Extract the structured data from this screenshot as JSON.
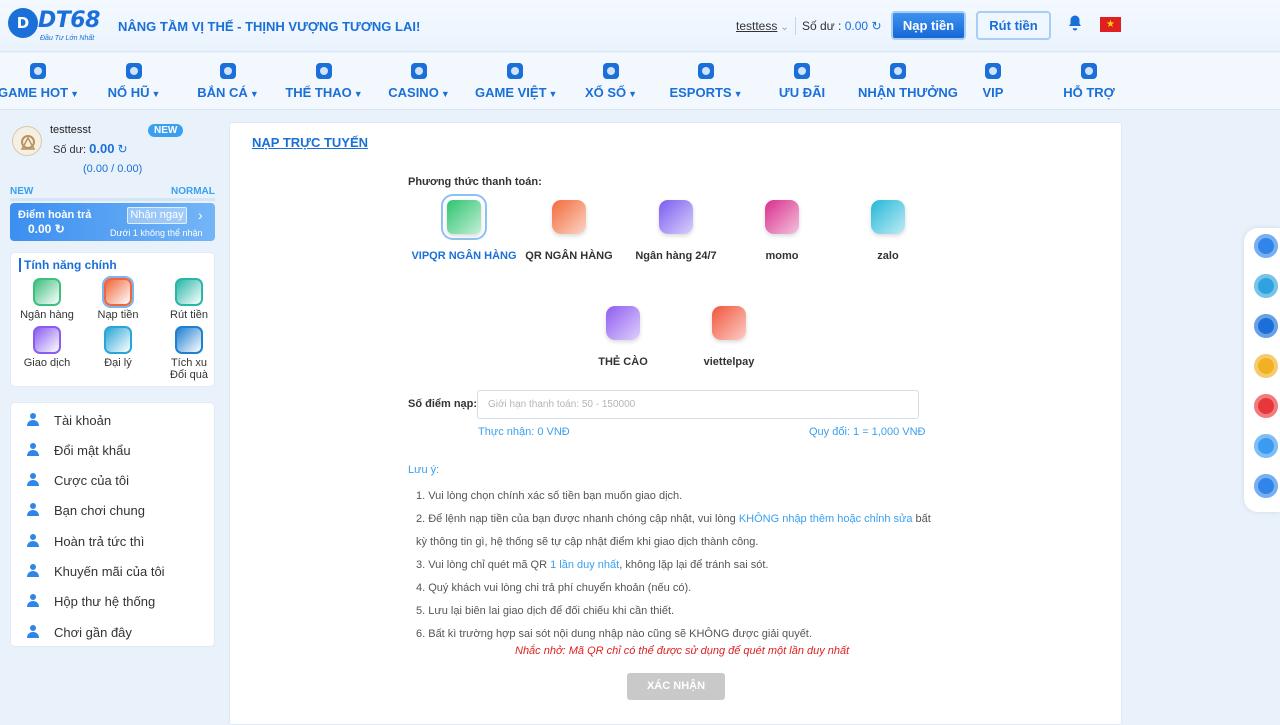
{
  "header": {
    "logo_text": "DT68",
    "logo_sub": "Đầu Tư Lớn Nhất",
    "slogan": "NÂNG TẦM VỊ THẾ - THỊNH VƯỢNG TƯƠNG LAI!",
    "username": "testtess",
    "balance_label": "Số dư :",
    "balance_value": "0.00",
    "deposit_btn": "Nạp tiền",
    "withdraw_btn": "Rút tiền"
  },
  "nav": [
    {
      "label": "GAME HOT",
      "caret": true,
      "icon": "game-hot-icon"
    },
    {
      "label": "NỔ HŨ",
      "caret": true,
      "icon": "slot-icon"
    },
    {
      "label": "BẮN CÁ",
      "caret": true,
      "icon": "fish-icon"
    },
    {
      "label": "THỂ THAO",
      "caret": true,
      "icon": "soccer-icon"
    },
    {
      "label": "CASINO",
      "caret": true,
      "icon": "casino-icon"
    },
    {
      "label": "GAME VIỆT",
      "caret": true,
      "icon": "cards-icon"
    },
    {
      "label": "XỔ SỐ",
      "caret": true,
      "icon": "lottery-icon"
    },
    {
      "label": "ESPORTS",
      "caret": true,
      "icon": "gamepad-icon"
    },
    {
      "label": "ƯU ĐÃI",
      "caret": false,
      "icon": "gift-icon"
    },
    {
      "label": "NHẬN THƯỞNG",
      "caret": false,
      "icon": "reward-icon"
    },
    {
      "label": "VIP",
      "caret": false,
      "icon": "crown-icon"
    },
    {
      "label": "HỖ TRỢ",
      "caret": false,
      "icon": "support-icon"
    }
  ],
  "sidebar": {
    "username": "testtesst",
    "badge": "NEW",
    "balance_label": "Số dư:",
    "balance_value": "0.00",
    "progress": "(0.00 / 0.00)",
    "level_left": "NEW",
    "level_right": "NORMAL",
    "cashback_title": "Điểm hoàn trả",
    "cashback_value": "0.00",
    "cashback_btn": "Nhận ngay",
    "cashback_note": "Dưới 1 không thể nhận",
    "features_title": "Tính năng chính",
    "features": [
      {
        "label": "Ngân hàng",
        "icon": "bank-icon",
        "color": "#3fbf7f"
      },
      {
        "label": "Nạp tiền",
        "icon": "deposit-icon",
        "color": "#f0663a"
      },
      {
        "label": "Rút tiền",
        "icon": "withdraw-icon",
        "color": "#29b7a8"
      },
      {
        "label": "Giao dịch",
        "icon": "transaction-icon",
        "color": "#8a5cf0"
      },
      {
        "label": "Đại lý",
        "icon": "agent-icon",
        "color": "#2aa6d6"
      },
      {
        "label": "Tích xu\nĐổi quà",
        "icon": "coin-gift-icon",
        "color": "#1f7fd0"
      }
    ],
    "menu": [
      {
        "label": "Tài khoản",
        "icon": "user-icon"
      },
      {
        "label": "Đổi mật khẩu",
        "icon": "lock-icon"
      },
      {
        "label": "Cược của tôi",
        "icon": "bet-icon"
      },
      {
        "label": "Bạn chơi chung",
        "icon": "friends-icon"
      },
      {
        "label": "Hoàn trả tức thì",
        "icon": "refund-icon"
      },
      {
        "label": "Khuyến mãi của tôi",
        "icon": "promo-icon"
      },
      {
        "label": "Hộp thư hệ thống",
        "icon": "mailbox-icon"
      },
      {
        "label": "Chơi gần đây",
        "icon": "history-icon"
      }
    ]
  },
  "main": {
    "title": "NẠP TRỰC TUYẾN",
    "methods_label": "Phương thức thanh toán:",
    "methods": [
      {
        "label": "VIPQR NGÂN HÀNG",
        "icon": "vipqr-icon",
        "color": "#2ec46f",
        "active": true
      },
      {
        "label": "QR NGÂN HÀNG",
        "icon": "qr-bank-icon",
        "color": "#f26a3b",
        "active": false
      },
      {
        "label": "Ngân hàng 24/7",
        "icon": "bank-247-icon",
        "color": "#7a5cf0",
        "active": false
      },
      {
        "label": "momo",
        "icon": "momo-icon",
        "color": "#d82d8b",
        "active": false
      },
      {
        "label": "zalo",
        "icon": "zalo-icon",
        "color": "#23b8d8",
        "active": false
      },
      {
        "label": "THẺ CÀO",
        "icon": "scratch-card-icon",
        "color": "#8e5cf0",
        "active": false
      },
      {
        "label": "viettelpay",
        "icon": "viettelpay-icon",
        "color": "#f2543a",
        "active": false
      }
    ],
    "amount_label": "Số điểm nạp:",
    "amount_placeholder": "Giới hạn thanh toán: 50 - 150000",
    "amount_value": "",
    "receive": "Thực nhận: 0 VNĐ",
    "rate": "Quy đổi: 1 = 1,000 VNĐ",
    "note_title": "Lưu ý:",
    "notes": [
      {
        "pre": "1. Vui lòng chọn chính xác số tiền bạn muốn giao dịch.",
        "hl": "",
        "post": ""
      },
      {
        "pre": "2. Để lệnh nạp tiền của bạn được nhanh chóng cập nhật, vui lòng ",
        "hl": "KHÔNG nhập thêm hoặc chỉnh sửa",
        "post": " bất kỳ thông tin gì, hệ thống sẽ tự cập nhật điểm khi giao dịch thành công."
      },
      {
        "pre": "3. Vui lòng chỉ quét mã QR ",
        "hl": "1 lần duy nhất",
        "post": ", không lặp lại để tránh sai sót."
      },
      {
        "pre": "4. Quý khách vui lòng chi trả phí chuyển khoản (nếu có).",
        "hl": "",
        "post": ""
      },
      {
        "pre": "5. Lưu lại biên lai giao dịch để đối chiếu khi cần thiết.",
        "hl": "",
        "post": ""
      },
      {
        "pre": "6. Bất kì trường hợp sai sót nội dung nhập nào cũng sẽ KHÔNG được giải quyết.",
        "hl": "",
        "post": ""
      }
    ],
    "reminder": "Nhắc nhở: Mã QR chỉ có thể được sử dụng để quét một lần duy nhất",
    "confirm_btn": "XÁC NHẬN"
  },
  "floating": [
    {
      "icon": "chat-icon",
      "color": "#2f86e8"
    },
    {
      "icon": "telegram-icon",
      "color": "#2fa3e0"
    },
    {
      "icon": "facebook-icon",
      "color": "#1a6fd8"
    },
    {
      "icon": "megaphone-icon",
      "color": "#f2b024"
    },
    {
      "icon": "mail-icon",
      "color": "#e8373a"
    },
    {
      "icon": "app-download-icon",
      "color": "#3a9bf0"
    },
    {
      "icon": "ticket-icon",
      "color": "#2f86e8"
    }
  ]
}
